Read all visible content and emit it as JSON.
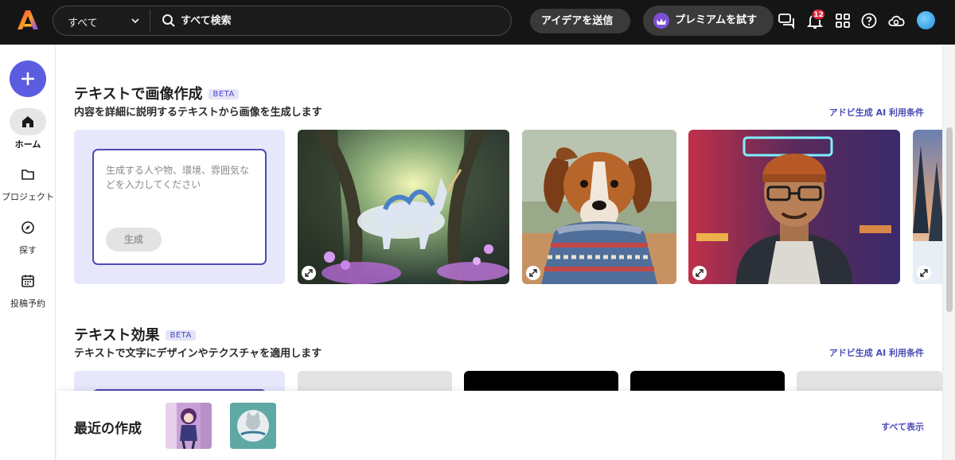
{
  "topbar": {
    "search_scope": "すべて",
    "search_placeholder": "すべて検索",
    "idea_button": "アイデアを送信",
    "premium_button": "プレミアムを試す",
    "notification_count": "12"
  },
  "sidebar": {
    "items": [
      {
        "label": "ホーム",
        "icon": "home-icon",
        "active": true
      },
      {
        "label": "プロジェクト",
        "icon": "folder-icon",
        "active": false
      },
      {
        "label": "探す",
        "icon": "compass-icon",
        "active": false
      },
      {
        "label": "投稿予約",
        "icon": "calendar-icon",
        "active": false
      }
    ]
  },
  "text_to_image": {
    "title": "テキストで画像作成",
    "badge": "BETA",
    "subtitle": "内容を詳細に説明するテキストから画像を生成します",
    "terms_link": "アドビ生成 AI 利用条件",
    "prompt_placeholder": "生成する人や物、環境、雰囲気などを入力してください",
    "generate_button": "生成"
  },
  "text_effects": {
    "title": "テキスト効果",
    "badge": "BETA",
    "subtitle": "テキストで文字にデザインやテクスチャを適用します",
    "terms_link": "アドビ生成 AI 利用条件"
  },
  "recent": {
    "title": "最近の作成",
    "show_all": "すべて表示"
  },
  "colors": {
    "accent": "#5c5ce0",
    "topbar": "#151515",
    "prompt_card": "#e7e7fb",
    "link": "#4a4ab8"
  }
}
